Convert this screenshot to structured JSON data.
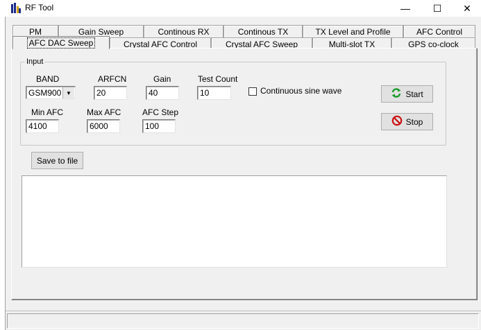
{
  "window": {
    "title": "RF Tool",
    "minimize_glyph": "—",
    "maximize_glyph": "☐",
    "close_glyph": "✕"
  },
  "tabs_row1": [
    "PM",
    "Gain Sweep",
    "Continous RX",
    "Continous TX",
    "TX Level and Profile",
    "AFC Control"
  ],
  "tabs_row2": [
    "AFC DAC Sweep",
    "Crystal AFC Control",
    "Crystal AFC Sweep",
    "Multi-slot TX",
    "GPS co-clock"
  ],
  "active_tab": "AFC DAC Sweep",
  "input_group": {
    "label": "Input",
    "band_label": "BAND",
    "band_value": "GSM900",
    "arfcn_label": "ARFCN",
    "arfcn_value": "20",
    "gain_label": "Gain",
    "gain_value": "40",
    "test_count_label": "Test Count",
    "test_count_value": "10",
    "continuous_label": "Continuous sine wave",
    "continuous_checked": false,
    "min_afc_label": "Min AFC",
    "min_afc_value": "4100",
    "max_afc_label": "Max AFC",
    "max_afc_value": "6000",
    "afc_step_label": "AFC Step",
    "afc_step_value": "100"
  },
  "buttons": {
    "start": "Start",
    "stop": "Stop",
    "save": "Save to file"
  },
  "icons": {
    "start": "refresh-icon",
    "stop": "no-entry-icon",
    "app": "app-logo-icon"
  },
  "colors": {
    "start_icon": "#1a9a2a",
    "stop_icon": "#cc1111"
  }
}
